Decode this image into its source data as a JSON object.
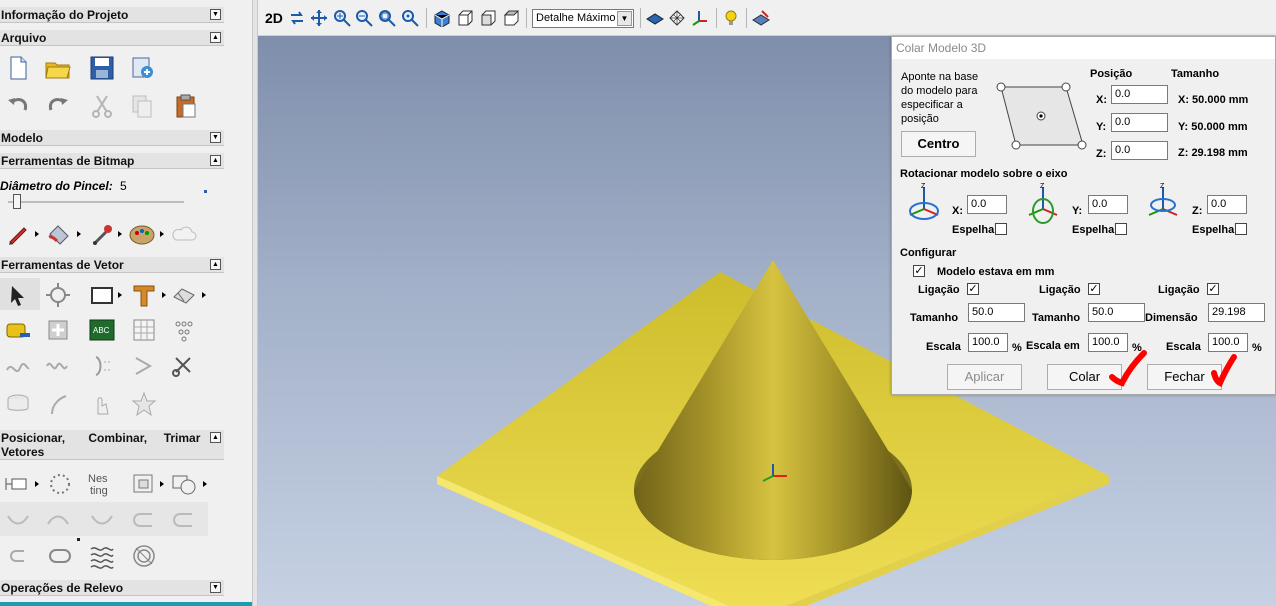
{
  "left_panel": {
    "sections": {
      "project_info": "Informação do Projeto",
      "file": "Arquivo",
      "model": "Modelo",
      "bitmap_tools": "Ferramentas de Bitmap",
      "vector_tools": "Ferramentas de Vetor",
      "position_combine": "Posicionar,       Combinar,     Trimar Vetores",
      "relief_ops": "Operações de Relevo"
    },
    "brush": {
      "label": "Diâmetro do Pincel:",
      "value": "5",
      "slider_fraction": 0.04
    }
  },
  "toolbar": {
    "view_2d": "2D",
    "detail_select": "Detalhe Máximo"
  },
  "dialog": {
    "title": "Colar Modelo 3D",
    "instruction": [
      "Aponte na base",
      "do modelo para",
      "especificar a",
      "posição"
    ],
    "center_button": "Centro",
    "position_header": "Posição",
    "size_header": "Tamanho",
    "pos": {
      "x_label": "X:",
      "x": "0.0",
      "y_label": "Y:",
      "y": "0.0",
      "z_label": "Z:",
      "z": "0.0"
    },
    "size": {
      "x": "X: 50.000 mm",
      "y": "Y: 50.000 mm",
      "z": "Z: 29.198 mm"
    },
    "rotate_label": "Rotacionar modelo sobre o eixo",
    "rot": {
      "x_label": "X:",
      "x": "0.0",
      "y_label": "Y:",
      "y": "0.0",
      "z_label": "Z:",
      "z": "0.0",
      "mirror": "Espelha"
    },
    "configure_label": "Configurar",
    "model_mm": {
      "label": "Modelo estava em mm",
      "checked": true
    },
    "link_label": "Ligação",
    "size_label": "Tamanho",
    "dimension_label": "Dimensão",
    "dims": {
      "x": "50.0",
      "y": "50.0",
      "z": "29.198"
    },
    "scale_label": "Escala",
    "scale_em_label": "Escala em",
    "scales": {
      "x": "100.0",
      "y": "100.0",
      "z": "100.0"
    },
    "percent": "%",
    "apply_button": "Aplicar",
    "paste_button": "Colar",
    "close_button": "Fechar"
  },
  "colors": {
    "viewport_top": "#7f8eab",
    "viewport_bottom": "#c6d1e3",
    "model_yellow": "#f2e25a",
    "cone_gold": "#b8a530",
    "annotation_red": "#ff0000"
  }
}
